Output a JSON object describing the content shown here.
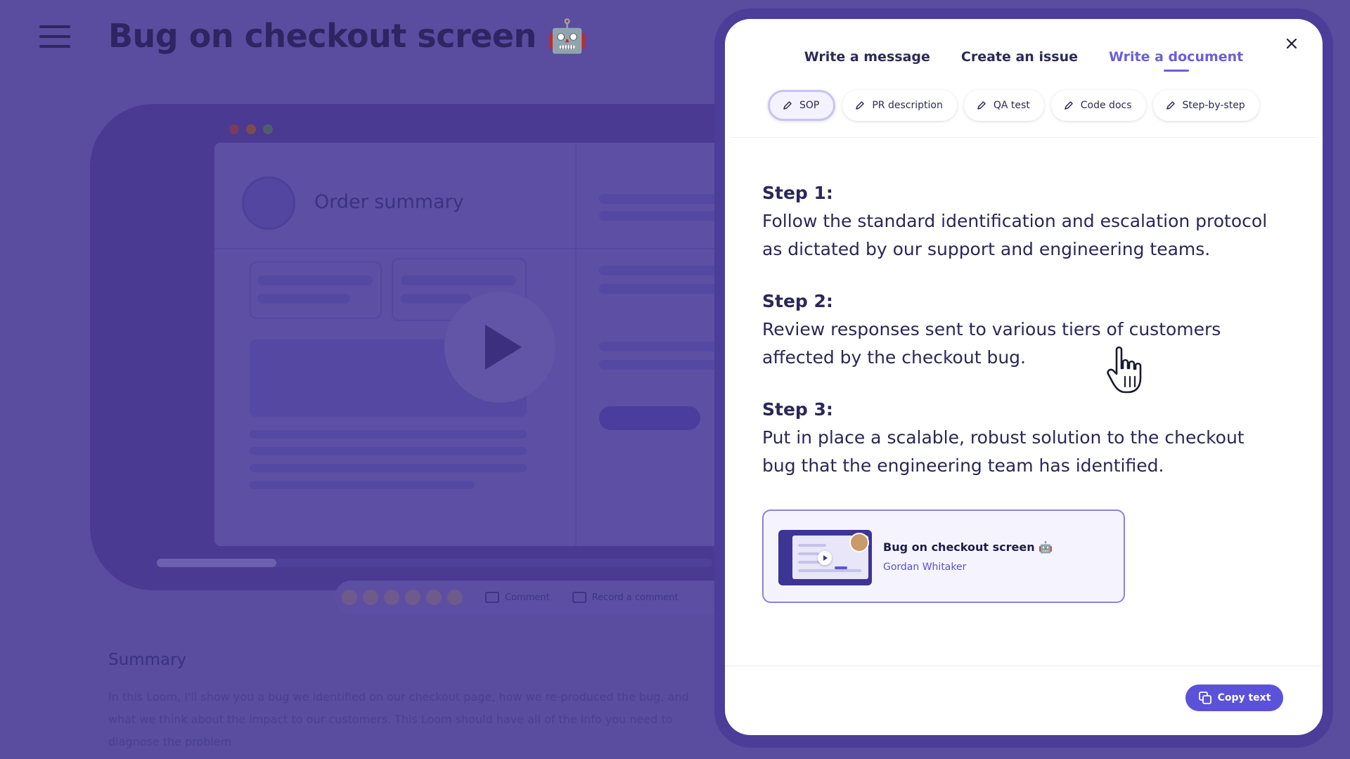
{
  "page": {
    "title": "Bug on checkout screen 🤖",
    "video": {
      "order_title": "Order summary",
      "traffic_colors": [
        "#7a3b5c",
        "#7b4c52",
        "#4f5e6c"
      ]
    },
    "reaction_bar": {
      "comment_label": "Comment",
      "record_label": "Record a comment"
    },
    "summary": {
      "heading": "Summary",
      "text": "In this Loom, I'll show you a bug we identified on our checkout page, how we re-produced the bug, and what we think about the impact to our customers. This Loom should have all of the info you need to diagnose the problem"
    }
  },
  "modal": {
    "tabs": [
      {
        "label": "Write a message",
        "active": false
      },
      {
        "label": "Create an issue",
        "active": false
      },
      {
        "label": "Write a document",
        "active": true
      }
    ],
    "doc_types": [
      {
        "label": "SOP",
        "active": true
      },
      {
        "label": "PR description",
        "active": false
      },
      {
        "label": "QA test",
        "active": false
      },
      {
        "label": "Code docs",
        "active": false
      },
      {
        "label": "Step-by-step",
        "active": false
      }
    ],
    "steps": [
      {
        "heading": "Step 1:",
        "body": "Follow the standard identification and escalation protocol as dictated by our support and engineering teams."
      },
      {
        "heading": "Step 2:",
        "body": "Review responses sent to various tiers of customers affected by the checkout bug."
      },
      {
        "heading": "Step 3:",
        "body": "Put in place a scalable, robust solution to the checkout bug that the engineering team has identified."
      }
    ],
    "embed": {
      "title": "Bug on checkout screen 🤖",
      "author": "Gordan Whitaker"
    },
    "copy_button": "Copy text"
  },
  "colors": {
    "accent": "#6b5fd8",
    "button": "#5b52da",
    "overlay": "#56479a"
  }
}
